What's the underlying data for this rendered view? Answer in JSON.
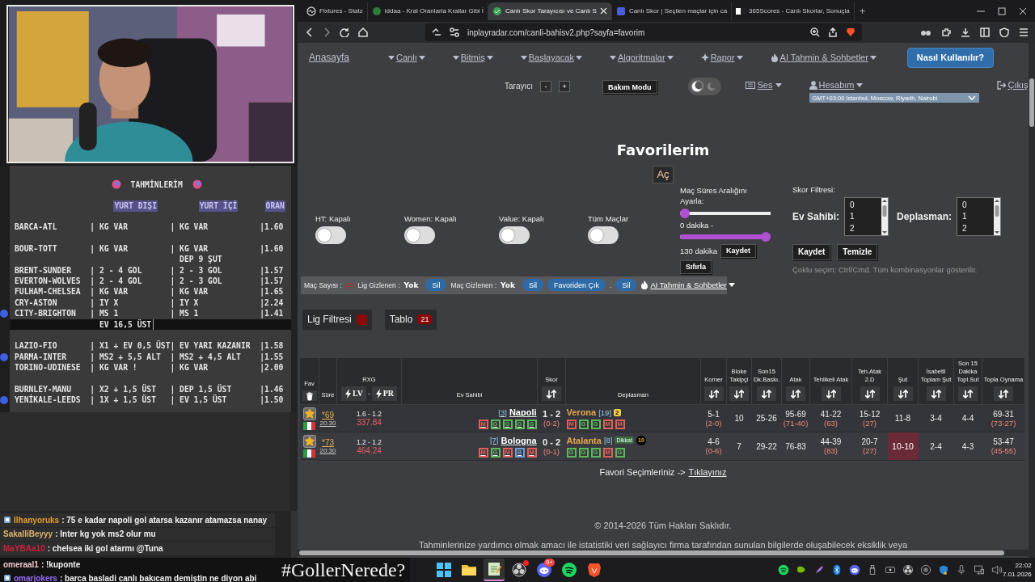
{
  "notes": {
    "title": "TAHMİNLERİM",
    "columns": [
      "YURT DIŞI",
      "YURT İÇİ",
      "ORAN"
    ],
    "lines": [
      {
        "kind": "row",
        "match": "BARCA-ATL",
        "abroad": "| KG VAR",
        "domestic": "| KG VAR",
        "odds": "|1.60",
        "marked": false
      },
      {
        "kind": "blank"
      },
      {
        "kind": "row",
        "match": "BOUR-TOTT",
        "abroad": "| KG VAR",
        "domestic": "| KG VAR",
        "odds": "|1.60",
        "marked": false
      },
      {
        "kind": "note",
        "text": "DEP 9 ŞUT"
      },
      {
        "kind": "row",
        "match": "BRENT-SUNDER",
        "abroad": "| 2 - 4 GOL",
        "domestic": "| 2 - 3 GOL",
        "odds": "|1.57",
        "marked": false
      },
      {
        "kind": "row",
        "match": "EVERTON-WOLVES",
        "abroad": "| 2 - 4 GOL",
        "domestic": "| 2 - 3 GOL",
        "odds": "|1.57",
        "marked": false
      },
      {
        "kind": "row",
        "match": "FULHAM-CHELSEA",
        "abroad": "| KG VAR",
        "domestic": "| KG VAR",
        "odds": "|1.65",
        "marked": false
      },
      {
        "kind": "row",
        "match": "CRY-ASTON",
        "abroad": "| IY X",
        "domestic": "| IY X",
        "odds": "|2.24",
        "marked": false
      },
      {
        "kind": "row",
        "match": "CITY-BRIGHTON",
        "abroad": "| MS 1",
        "domestic": "| MS 1",
        "odds": "|1.41",
        "marked": true
      },
      {
        "kind": "highlight",
        "text": "EV 16,5 ÜST"
      },
      {
        "kind": "blank"
      },
      {
        "kind": "row",
        "match": "LAZIO-FIO",
        "abroad": "| X1 + EV 0,5 ÜST",
        "domestic": "| EV YARI KAZANIR",
        "odds": "|1.58",
        "marked": false
      },
      {
        "kind": "row",
        "match": "PARMA-INTER",
        "abroad": "| MS2 + 5,5 ALT",
        "domestic": "| MS2 + 4,5 ALT",
        "odds": "|1.55",
        "marked": true
      },
      {
        "kind": "row",
        "match": "TORINO-UDINESE",
        "abroad": "| KG VAR !",
        "domestic": "| KG VAR",
        "odds": "|2.00",
        "marked": false
      },
      {
        "kind": "blank"
      },
      {
        "kind": "row",
        "match": "BURNLEY-MANU",
        "abroad": "| X2 + 1,5 ÜST",
        "domestic": "| DEP 1,5 ÜST",
        "odds": "|1.46",
        "marked": false
      },
      {
        "kind": "row",
        "match": "YENİKALE-LEEDS",
        "abroad": "| 1X + 1,5 ÜST",
        "domestic": "| EV 1,5 ÜST",
        "odds": "|1.50",
        "marked": true
      }
    ]
  },
  "chat": [
    {
      "user": "Ilhanyoruks",
      "color": "#e39b2f",
      "badge": true,
      "text": ": 75 e kadar napoli gol atarsa kazanır atamazsa nanay"
    },
    {
      "user": "SakalliBeyyy",
      "color": "#dcb46e",
      "badge": false,
      "text": ": Inter kg yok ms2 olur mu"
    },
    {
      "user": "MaYBAa10",
      "color": "#d0203c",
      "badge": false,
      "text": ": chelsea iki gol atarmı @Tuna"
    },
    {
      "user": "omeraal1",
      "color": "#f2c4cc",
      "badge": false,
      "text": ": !kuponte"
    },
    {
      "user": "omarjokers",
      "color": "#9c6bff",
      "badge": true,
      "text": ": barca basladi canlı bakıcam demiştin ne diyon abi"
    }
  ],
  "overlay_text": "#GollerNerede?",
  "browser": {
    "tabs": [
      {
        "title": "Fixtures - Statz",
        "selected": false
      },
      {
        "title": "iddaa - Kral Oranlarla Krallar Gibi İ",
        "selected": false
      },
      {
        "title": "Canlı Skor Tarayıcısı ve Canlı S",
        "selected": true
      },
      {
        "title": "Canlı Skor | Seçilen maçlar için ca",
        "selected": false
      },
      {
        "title": "365Scores - Canlı Skorlar, Sonuçla",
        "selected": false
      }
    ],
    "new_tab": "+",
    "url": "inplayradar.com/canli-bahisv2.php?sayfa=favorim"
  },
  "nav": {
    "home": "Anasayfa",
    "menus": [
      {
        "label": "Canlı",
        "kind": "caret"
      },
      {
        "label": "Bitmiş",
        "kind": "caret"
      },
      {
        "label": "Başlayacak",
        "kind": "caret"
      },
      {
        "label": "Algoritmalar",
        "kind": "caret"
      },
      {
        "label": "Rapor",
        "kind": "compass"
      },
      {
        "label": "AI Tahmin & Sohbetler",
        "kind": "flame"
      }
    ],
    "help": "Nasıl Kullanılır?"
  },
  "toolbar": {
    "scanner": "Tarayıcı",
    "minus": "-",
    "plus": "+",
    "maintenance": "Bakım Modu",
    "dark_mode": true,
    "sound": "Ses",
    "account": "Hesabım",
    "timezone": "GMT+03:00 Istanbul, Moscow, Riyadh, Nairobi",
    "logout": "Çıkış"
  },
  "favorites": {
    "title": "Favorilerim",
    "open": "Aç",
    "switches": [
      {
        "label": "HT: Kapalı",
        "on": false
      },
      {
        "label": "Women: Kapalı",
        "on": false
      },
      {
        "label": "Value: Kapalı",
        "on": false
      },
      {
        "label": "Tüm Maçlar",
        "on": false
      }
    ],
    "duration": {
      "label": "Maç Süres Aralığını Ayarla:",
      "sliders": [
        {
          "level": 0,
          "reading": "0 dakika -"
        },
        {
          "level": 1,
          "reading": "130 dakika"
        }
      ],
      "save": "Kaydet",
      "reset": "Sıfırla"
    },
    "score_filter": {
      "title": "Skor Filtresi:",
      "lists": [
        {
          "label": "Ev Sahibi:",
          "options": [
            "0",
            "1",
            "2"
          ]
        },
        {
          "label": "Deplasman:",
          "options": [
            "0",
            "1",
            "2"
          ]
        }
      ],
      "save": "Kaydet",
      "clear": "Temizle",
      "hint": "Çoklu seçim: Ctrl/Cmd. Tüm kombinasyonlar gösterilir."
    }
  },
  "bar": [
    {
      "kind": "label",
      "text": "Maç Sayısı :"
    },
    {
      "kind": "count",
      "text": "(2)"
    },
    {
      "kind": "label",
      "text": "Lig Gizlenen :"
    },
    {
      "kind": "value",
      "text": "Yok"
    },
    {
      "kind": "pill",
      "text": "Sil"
    },
    {
      "kind": "label",
      "text": "Maç Gizlenen :"
    },
    {
      "kind": "value",
      "text": "Yok"
    },
    {
      "kind": "pill",
      "text": "Sil"
    },
    {
      "kind": "pill",
      "text": "Favoriden Çık"
    },
    {
      "kind": "label",
      "text": "."
    },
    {
      "kind": "pill",
      "text": "Sil"
    },
    {
      "kind": "menu",
      "text": "AI Tahmin & Sohbetler"
    }
  ],
  "panels": [
    {
      "label": "Lig Filtresi",
      "kind": "swatch"
    },
    {
      "label": "Tablo",
      "kind": "count",
      "count": "21"
    }
  ],
  "table": {
    "columns": [
      {
        "label": "Fav",
        "kind": "trash"
      },
      {
        "label": "Süre",
        "kind": "plain"
      },
      {
        "label": "RXG",
        "kind": "rxg",
        "buttons": [
          "LV",
          "PR"
        ],
        "separator": "-"
      },
      {
        "label": "Ev Sahibi",
        "kind": "plain"
      },
      {
        "label": "Skor",
        "kind": "sort"
      },
      {
        "label": "Deplasman",
        "kind": "plain"
      },
      {
        "label": "Korner",
        "kind": "sort"
      },
      {
        "label": "Bloke Takipçi",
        "kind": "sort"
      },
      {
        "label": "Son15 Dk.Baskı.",
        "kind": "sort"
      },
      {
        "label": "Atak",
        "kind": "sort"
      },
      {
        "label": "Tehlikeli Atak",
        "kind": "sort"
      },
      {
        "label": "Teh.Atak 2.D",
        "kind": "sort"
      },
      {
        "label": "Şut",
        "kind": "sort"
      },
      {
        "label": "İsabetli Toplam Şut",
        "kind": "sort"
      },
      {
        "label": "Son 15 Dakika Topl.Sut",
        "kind": "sort"
      },
      {
        "label": "Topla Oynama",
        "kind": "sort"
      }
    ],
    "rows": [
      {
        "favorite": true,
        "minute": "*69",
        "time": "20:30",
        "rxg": "1.6 - 1.2",
        "rxg_total": "337.84",
        "home": {
          "rank": "[3]",
          "name": "Napoli",
          "form": [
            {
              "letter": "M",
              "color": "#e0605a"
            },
            {
              "letter": "G",
              "color": "#5cb85c"
            },
            {
              "letter": "G",
              "color": "#5cb85c"
            },
            {
              "letter": "G",
              "color": "#5cb85c"
            },
            {
              "letter": "G",
              "color": "#5cb85c"
            }
          ]
        },
        "score": "1 - 2",
        "half": "(0-2)",
        "away": {
          "name": "Verona",
          "rank": "[19]",
          "badges": [
            {
              "kind": "card",
              "text": "2"
            }
          ],
          "form": [
            {
              "letter": "M",
              "color": "#e0605a"
            },
            {
              "letter": "G",
              "color": "#5cb85c"
            },
            {
              "letter": "G",
              "color": "#5cb85c"
            },
            {
              "letter": "M",
              "color": "#e0605a"
            },
            {
              "letter": "M",
              "color": "#e0605a"
            }
          ]
        },
        "stats": [
          {
            "value": "5-1",
            "sub": "(2-0)",
            "alert": false
          },
          {
            "value": "10",
            "alert": false
          },
          {
            "value": "25-26",
            "alert": false
          },
          {
            "value": "95-69",
            "sub": "(71-40)",
            "alert": false
          },
          {
            "value": "41-22",
            "sub": "(63)",
            "alert": false
          },
          {
            "value": "15-12",
            "sub": "(27)",
            "alert": false
          },
          {
            "value": "11-8",
            "alert": false
          },
          {
            "value": "3-4",
            "alert": false
          },
          {
            "value": "4-4",
            "alert": false
          },
          {
            "value": "69-31",
            "sub": "(73-27)",
            "alert": false
          }
        ]
      },
      {
        "favorite": true,
        "minute": "*73",
        "time": "20:30",
        "rxg": "1.2 - 1.2",
        "rxg_total": "464.24",
        "home": {
          "rank": "[7]",
          "name": "Bologna",
          "form": [
            {
              "letter": "M",
              "color": "#e0605a"
            },
            {
              "letter": "G",
              "color": "#5cb85c"
            },
            {
              "letter": "M",
              "color": "#e0605a"
            },
            {
              "letter": "B",
              "color": "#6fa0d8"
            },
            {
              "letter": "M",
              "color": "#e0605a"
            }
          ]
        },
        "score": "0 - 2",
        "half": "(0-1)",
        "away": {
          "name": "Atalanta",
          "rank": "[8]",
          "badges": [
            {
              "kind": "tag",
              "text": "Dikkat"
            },
            {
              "kind": "circle",
              "text": "10"
            }
          ],
          "form": [
            {
              "letter": "G",
              "color": "#5cb85c"
            },
            {
              "letter": "G",
              "color": "#5cb85c"
            },
            {
              "letter": "G",
              "color": "#5cb85c"
            },
            {
              "letter": "M",
              "color": "#e0605a"
            },
            {
              "letter": "G",
              "color": "#5cb85c"
            }
          ]
        },
        "stats": [
          {
            "value": "4-6",
            "sub": "(0-6)",
            "alert": false
          },
          {
            "value": "7",
            "alert": false
          },
          {
            "value": "29-22",
            "alert": false
          },
          {
            "value": "76-83",
            "alert": false
          },
          {
            "value": "44-39",
            "sub": "(83)",
            "alert": false
          },
          {
            "value": "20-7",
            "sub": "(27)",
            "alert": false
          },
          {
            "value": "10-10",
            "alert": true
          },
          {
            "value": "2-4",
            "alert": false
          },
          {
            "value": "4-3",
            "alert": false
          },
          {
            "value": "53-47",
            "sub": "(45-55)",
            "alert": false
          }
        ]
      }
    ]
  },
  "fav_prompt": {
    "text": "Favori Seçimleriniz ->",
    "link": "Tıklayınız"
  },
  "footer": {
    "copyright": "© 2014-2026 Tüm Hakları Saklıdır.",
    "disclaimer": "Tahminlerinize yardımcı olmak amacı ile istatistiki veri sağlayıcı firma tarafından sunulan bilgilerde oluşabilecek eksiklik veya"
  },
  "taskbar": {
    "apps": [
      {
        "kind": "windows",
        "active": false
      },
      {
        "kind": "folder",
        "active": false
      },
      {
        "kind": "notepad",
        "active": true
      },
      {
        "kind": "obs",
        "active": false,
        "dot": true
      },
      {
        "kind": "discord",
        "active": false,
        "badge": "9+"
      },
      {
        "kind": "spotify",
        "active": false
      },
      {
        "kind": "brave",
        "active": false
      }
    ],
    "time": "22:02",
    "date": "7.01.2026"
  }
}
